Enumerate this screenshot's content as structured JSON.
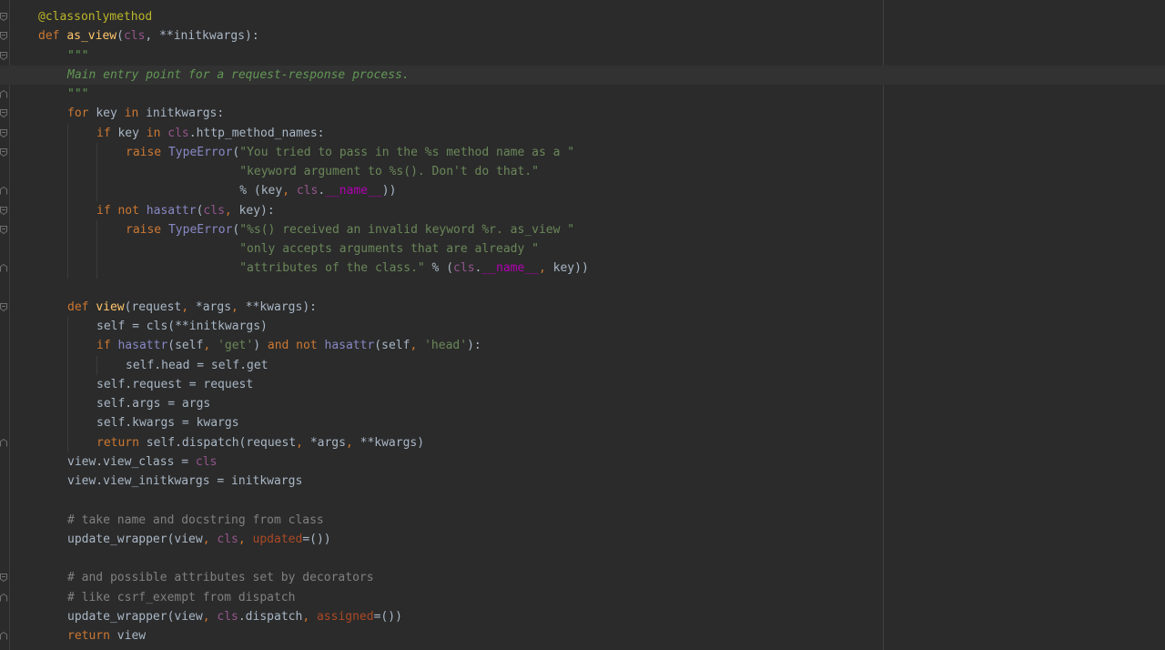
{
  "editor": {
    "current_line_index": 3,
    "lines": [
      {
        "indent": 0,
        "fold": "start",
        "tokens": [
          {
            "t": "@classonlymethod",
            "c": "deco"
          }
        ]
      },
      {
        "indent": 0,
        "fold": "start",
        "tokens": [
          {
            "t": "def ",
            "c": "kw"
          },
          {
            "t": "as_view",
            "c": "fn"
          },
          {
            "t": "(",
            "c": "plain"
          },
          {
            "t": "cls",
            "c": "self"
          },
          {
            "t": ", **initkwargs):",
            "c": "plain"
          }
        ]
      },
      {
        "indent": 1,
        "fold": "start",
        "tokens": [
          {
            "t": "\"\"\"",
            "c": "doc"
          }
        ]
      },
      {
        "indent": 1,
        "fold": "none",
        "tokens": [
          {
            "t": "Main entry point for a request-response process.",
            "c": "doc"
          }
        ]
      },
      {
        "indent": 1,
        "fold": "end",
        "tokens": [
          {
            "t": "\"\"\"",
            "c": "doc"
          }
        ]
      },
      {
        "indent": 1,
        "fold": "start",
        "tokens": [
          {
            "t": "for ",
            "c": "kw"
          },
          {
            "t": "key ",
            "c": "plain"
          },
          {
            "t": "in ",
            "c": "kw"
          },
          {
            "t": "initkwargs:",
            "c": "plain"
          }
        ]
      },
      {
        "indent": 2,
        "fold": "start",
        "tokens": [
          {
            "t": "if ",
            "c": "kw"
          },
          {
            "t": "key ",
            "c": "plain"
          },
          {
            "t": "in ",
            "c": "kw"
          },
          {
            "t": "cls",
            "c": "self"
          },
          {
            "t": ".http_method_names:",
            "c": "plain"
          }
        ]
      },
      {
        "indent": 3,
        "fold": "start",
        "tokens": [
          {
            "t": "raise ",
            "c": "kw"
          },
          {
            "t": "TypeError",
            "c": "builtin"
          },
          {
            "t": "(",
            "c": "plain"
          },
          {
            "t": "\"You tried to pass in the %s method name as a \"",
            "c": "str"
          }
        ]
      },
      {
        "indent": 3,
        "fold": "none",
        "tokens": [
          {
            "t": "                ",
            "c": "plain"
          },
          {
            "t": "\"keyword argument to %s(). Don't do that.\"",
            "c": "str"
          }
        ]
      },
      {
        "indent": 3,
        "fold": "end",
        "tokens": [
          {
            "t": "                % (key",
            "c": "plain"
          },
          {
            "t": ", ",
            "c": "kw"
          },
          {
            "t": "cls",
            "c": "self"
          },
          {
            "t": ".",
            "c": "plain"
          },
          {
            "t": "__name__",
            "c": "dunder"
          },
          {
            "t": "))",
            "c": "plain"
          }
        ]
      },
      {
        "indent": 2,
        "fold": "start",
        "tokens": [
          {
            "t": "if not ",
            "c": "kw"
          },
          {
            "t": "hasattr",
            "c": "builtin"
          },
          {
            "t": "(",
            "c": "plain"
          },
          {
            "t": "cls",
            "c": "self"
          },
          {
            "t": ", ",
            "c": "kw"
          },
          {
            "t": "key):",
            "c": "plain"
          }
        ]
      },
      {
        "indent": 3,
        "fold": "start",
        "tokens": [
          {
            "t": "raise ",
            "c": "kw"
          },
          {
            "t": "TypeError",
            "c": "builtin"
          },
          {
            "t": "(",
            "c": "plain"
          },
          {
            "t": "\"%s() received an invalid keyword %r. as_view \"",
            "c": "str"
          }
        ]
      },
      {
        "indent": 3,
        "fold": "none",
        "tokens": [
          {
            "t": "                ",
            "c": "plain"
          },
          {
            "t": "\"only accepts arguments that are already \"",
            "c": "str"
          }
        ]
      },
      {
        "indent": 3,
        "fold": "end",
        "tokens": [
          {
            "t": "                ",
            "c": "plain"
          },
          {
            "t": "\"attributes of the class.\"",
            "c": "str"
          },
          {
            "t": " % (",
            "c": "plain"
          },
          {
            "t": "cls",
            "c": "self"
          },
          {
            "t": ".",
            "c": "plain"
          },
          {
            "t": "__name__",
            "c": "dunder"
          },
          {
            "t": ", ",
            "c": "kw"
          },
          {
            "t": "key))",
            "c": "plain"
          }
        ]
      },
      {
        "indent": 0,
        "fold": "none",
        "tokens": []
      },
      {
        "indent": 1,
        "fold": "start",
        "tokens": [
          {
            "t": "def ",
            "c": "kw"
          },
          {
            "t": "view",
            "c": "fn"
          },
          {
            "t": "(request",
            "c": "plain"
          },
          {
            "t": ", ",
            "c": "kw"
          },
          {
            "t": "*args",
            "c": "plain"
          },
          {
            "t": ", ",
            "c": "kw"
          },
          {
            "t": "**kwargs):",
            "c": "plain"
          }
        ]
      },
      {
        "indent": 2,
        "fold": "none",
        "tokens": [
          {
            "t": "self = ",
            "c": "plain"
          },
          {
            "t": "cls(**initkwargs)",
            "c": "plain"
          }
        ]
      },
      {
        "indent": 2,
        "fold": "none",
        "tokens": [
          {
            "t": "if ",
            "c": "kw"
          },
          {
            "t": "hasattr",
            "c": "builtin"
          },
          {
            "t": "(self",
            "c": "plain"
          },
          {
            "t": ", ",
            "c": "kw"
          },
          {
            "t": "'get'",
            "c": "str"
          },
          {
            "t": ") ",
            "c": "plain"
          },
          {
            "t": "and not ",
            "c": "kw"
          },
          {
            "t": "hasattr",
            "c": "builtin"
          },
          {
            "t": "(self",
            "c": "plain"
          },
          {
            "t": ", ",
            "c": "kw"
          },
          {
            "t": "'head'",
            "c": "str"
          },
          {
            "t": "):",
            "c": "plain"
          }
        ]
      },
      {
        "indent": 3,
        "fold": "none",
        "tokens": [
          {
            "t": "self.head = self.get",
            "c": "plain"
          }
        ]
      },
      {
        "indent": 2,
        "fold": "none",
        "tokens": [
          {
            "t": "self.request = request",
            "c": "plain"
          }
        ]
      },
      {
        "indent": 2,
        "fold": "none",
        "tokens": [
          {
            "t": "self.args = args",
            "c": "plain"
          }
        ]
      },
      {
        "indent": 2,
        "fold": "none",
        "tokens": [
          {
            "t": "self.kwargs = kwargs",
            "c": "plain"
          }
        ]
      },
      {
        "indent": 2,
        "fold": "end",
        "tokens": [
          {
            "t": "return ",
            "c": "kw"
          },
          {
            "t": "self.dispatch(request",
            "c": "plain"
          },
          {
            "t": ", ",
            "c": "kw"
          },
          {
            "t": "*args",
            "c": "plain"
          },
          {
            "t": ", ",
            "c": "kw"
          },
          {
            "t": "**kwargs)",
            "c": "plain"
          }
        ]
      },
      {
        "indent": 1,
        "fold": "none",
        "tokens": [
          {
            "t": "view.view_class = ",
            "c": "plain"
          },
          {
            "t": "cls",
            "c": "self"
          }
        ]
      },
      {
        "indent": 1,
        "fold": "none",
        "tokens": [
          {
            "t": "view.view_initkwargs = initkwargs",
            "c": "plain"
          }
        ]
      },
      {
        "indent": 0,
        "fold": "none",
        "tokens": []
      },
      {
        "indent": 1,
        "fold": "none",
        "tokens": [
          {
            "t": "# take name and docstring from class",
            "c": "com"
          }
        ]
      },
      {
        "indent": 1,
        "fold": "none",
        "tokens": [
          {
            "t": "update_wrapper(view",
            "c": "plain"
          },
          {
            "t": ", ",
            "c": "kw"
          },
          {
            "t": "cls",
            "c": "self"
          },
          {
            "t": ", ",
            "c": "kw"
          },
          {
            "t": "updated",
            "c": "param"
          },
          {
            "t": "=())",
            "c": "plain"
          }
        ]
      },
      {
        "indent": 0,
        "fold": "none",
        "tokens": []
      },
      {
        "indent": 1,
        "fold": "start",
        "tokens": [
          {
            "t": "# and possible attributes set by decorators",
            "c": "com"
          }
        ]
      },
      {
        "indent": 1,
        "fold": "end",
        "tokens": [
          {
            "t": "# like csrf_exempt from dispatch",
            "c": "com"
          }
        ]
      },
      {
        "indent": 1,
        "fold": "none",
        "tokens": [
          {
            "t": "update_wrapper(view",
            "c": "plain"
          },
          {
            "t": ", ",
            "c": "kw"
          },
          {
            "t": "cls",
            "c": "self"
          },
          {
            "t": ".dispatch",
            "c": "plain"
          },
          {
            "t": ", ",
            "c": "kw"
          },
          {
            "t": "assigned",
            "c": "param"
          },
          {
            "t": "=())",
            "c": "plain"
          }
        ]
      },
      {
        "indent": 1,
        "fold": "end",
        "tokens": [
          {
            "t": "return ",
            "c": "kw"
          },
          {
            "t": "view",
            "c": "plain"
          }
        ]
      }
    ]
  }
}
